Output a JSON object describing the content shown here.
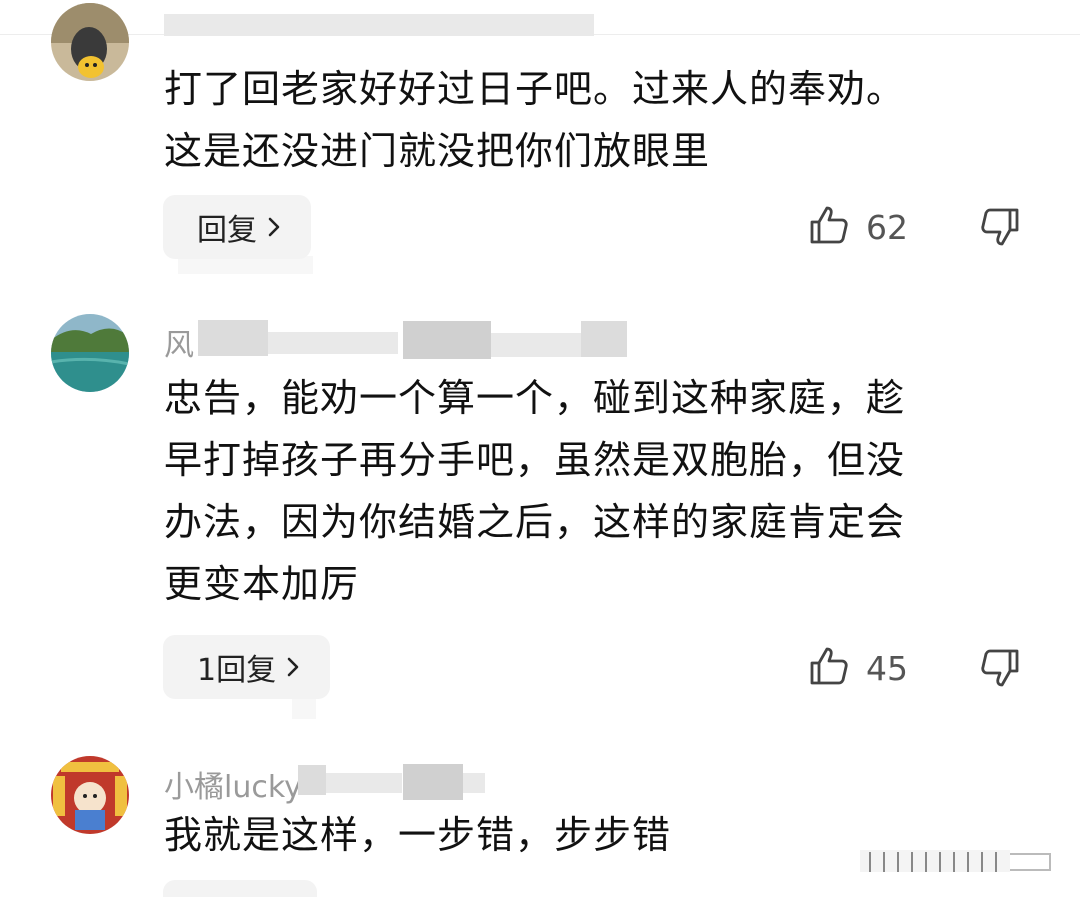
{
  "comments": [
    {
      "username": "",
      "text_lines": [
        "打了回老家好好过日子吧。过来人的奉劝。",
        "这是还没进门就没把你们放眼里"
      ],
      "reply_label": "回复",
      "likes": "62"
    },
    {
      "username": "风",
      "text_lines": [
        "忠告，能劝一个算一个，碰到这种家庭，趁",
        "早打掉孩子再分手吧，虽然是双胞胎，但没",
        "办法，因为你结婚之后，这样的家庭肯定会",
        "更变本加厉"
      ],
      "reply_label": "1回复",
      "likes": "45"
    },
    {
      "username": "小橘lucky",
      "text_lines": [
        "我就是这样，一步错，步步错"
      ],
      "reply_label": "",
      "likes": ""
    }
  ],
  "icons": {
    "like": "thumbs-up-icon",
    "dislike": "thumbs-down-icon",
    "chevron": "chevron-right-icon"
  },
  "colors": {
    "username": "#9a9a9a",
    "text": "#111111",
    "reply_bg": "#f3f3f3",
    "like_count": "#555555"
  }
}
